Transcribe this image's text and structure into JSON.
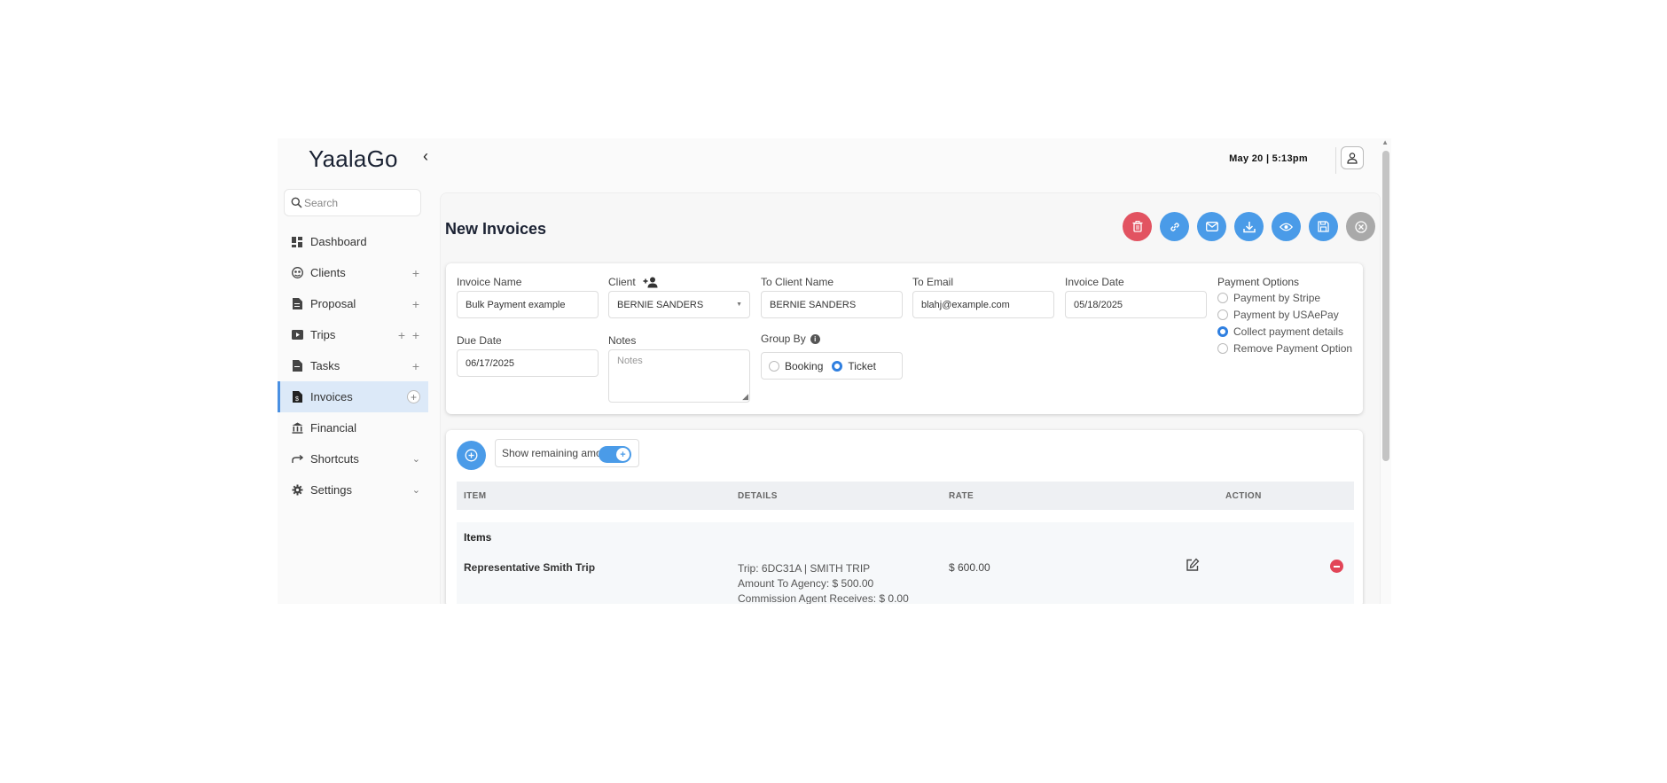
{
  "app": {
    "logo": "YaalaGo",
    "datetime": "May 20 | 5:13pm"
  },
  "sidebar": {
    "search_placeholder": "Search",
    "items": [
      {
        "label": "Dashboard",
        "icon": "dashboard-icon"
      },
      {
        "label": "Clients",
        "icon": "clients-icon"
      },
      {
        "label": "Proposal",
        "icon": "proposal-icon"
      },
      {
        "label": "Trips",
        "icon": "trips-icon"
      },
      {
        "label": "Tasks",
        "icon": "tasks-icon"
      },
      {
        "label": "Invoices",
        "icon": "invoices-icon",
        "active": true
      },
      {
        "label": "Financial",
        "icon": "bank-icon"
      },
      {
        "label": "Shortcuts",
        "icon": "shortcut-arrow-icon"
      },
      {
        "label": "Settings",
        "icon": "gear-icon"
      }
    ]
  },
  "page": {
    "title": "New Invoices",
    "action_icons": [
      "trash-icon",
      "link-icon",
      "mail-icon",
      "download-icon",
      "eye-icon",
      "save-icon",
      "close-icon"
    ],
    "colors": {
      "primary": "#4a9be8",
      "danger": "#e25361",
      "muted": "#a9a9a9"
    }
  },
  "form": {
    "invoice_name_label": "Invoice Name",
    "invoice_name_value": "Bulk Payment example",
    "client_label": "Client",
    "client_value": "BERNIE SANDERS",
    "to_client_name_label": "To Client Name",
    "to_client_name_value": "BERNIE SANDERS",
    "to_email_label": "To Email",
    "to_email_value": "blahj@example.com",
    "invoice_date_label": "Invoice Date",
    "invoice_date_value": "05/18/2025",
    "due_date_label": "Due Date",
    "due_date_value": "06/17/2025",
    "notes_label": "Notes",
    "notes_placeholder": "Notes",
    "group_by_label": "Group By",
    "group_by_options": [
      "Booking",
      "Ticket"
    ],
    "group_by_selected": "Ticket",
    "payment_options_label": "Payment Options",
    "payment_options": [
      "Payment by Stripe",
      "Payment by USAePay",
      "Collect payment details",
      "Remove Payment Option"
    ],
    "payment_selected": "Collect payment details"
  },
  "items": {
    "show_remaining_label": "Show remaining amount",
    "show_remaining_on": true,
    "columns": [
      "ITEM",
      "DETAILS",
      "RATE",
      "ACTION"
    ],
    "group_title": "Items",
    "rows": [
      {
        "item": "Representative Smith Trip",
        "details": [
          "Trip: 6DC31A | SMITH TRIP",
          "Amount To Agency: $ 500.00",
          "Commission Agent Receives: $ 0.00"
        ],
        "rate": "$ 600.00"
      }
    ]
  }
}
